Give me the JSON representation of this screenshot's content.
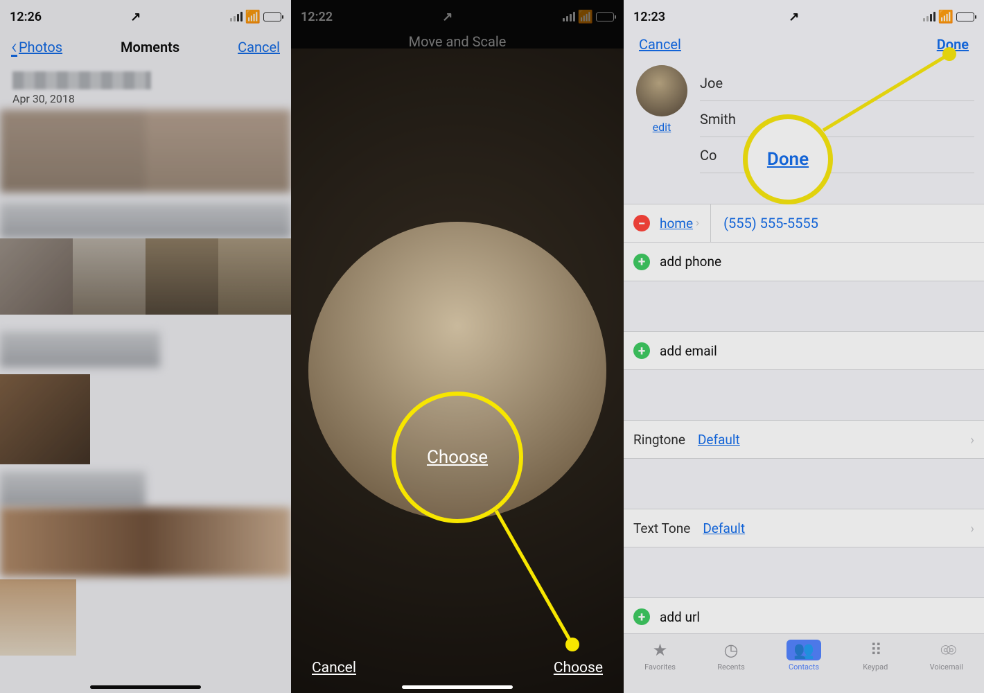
{
  "screenA": {
    "status": {
      "time": "12:26"
    },
    "nav": {
      "back": "Photos",
      "title": "Moments",
      "cancel": "Cancel"
    },
    "section_date": "Apr 30, 2018"
  },
  "screenB": {
    "status": {
      "time": "12:22"
    },
    "header": "Move and Scale",
    "footer": {
      "cancel": "Cancel",
      "choose": "Choose"
    },
    "callout_label": "Choose"
  },
  "screenC": {
    "status": {
      "time": "12:23"
    },
    "nav": {
      "cancel": "Cancel",
      "done": "Done"
    },
    "edit_link": "edit",
    "callout_label": "Done",
    "name_first": "Joe",
    "name_last": "Smith",
    "name_company_prefix": "Co",
    "phone": {
      "label": "home",
      "value": "(555) 555-5555"
    },
    "rows": {
      "add_phone": "add phone",
      "add_email": "add email",
      "ringtone_key": "Ringtone",
      "ringtone_val": "Default",
      "texttone_key": "Text Tone",
      "texttone_val": "Default",
      "add_url": "add url"
    },
    "tabs": {
      "favorites": "Favorites",
      "recents": "Recents",
      "contacts": "Contacts",
      "keypad": "Keypad",
      "voicemail": "Voicemail"
    }
  }
}
